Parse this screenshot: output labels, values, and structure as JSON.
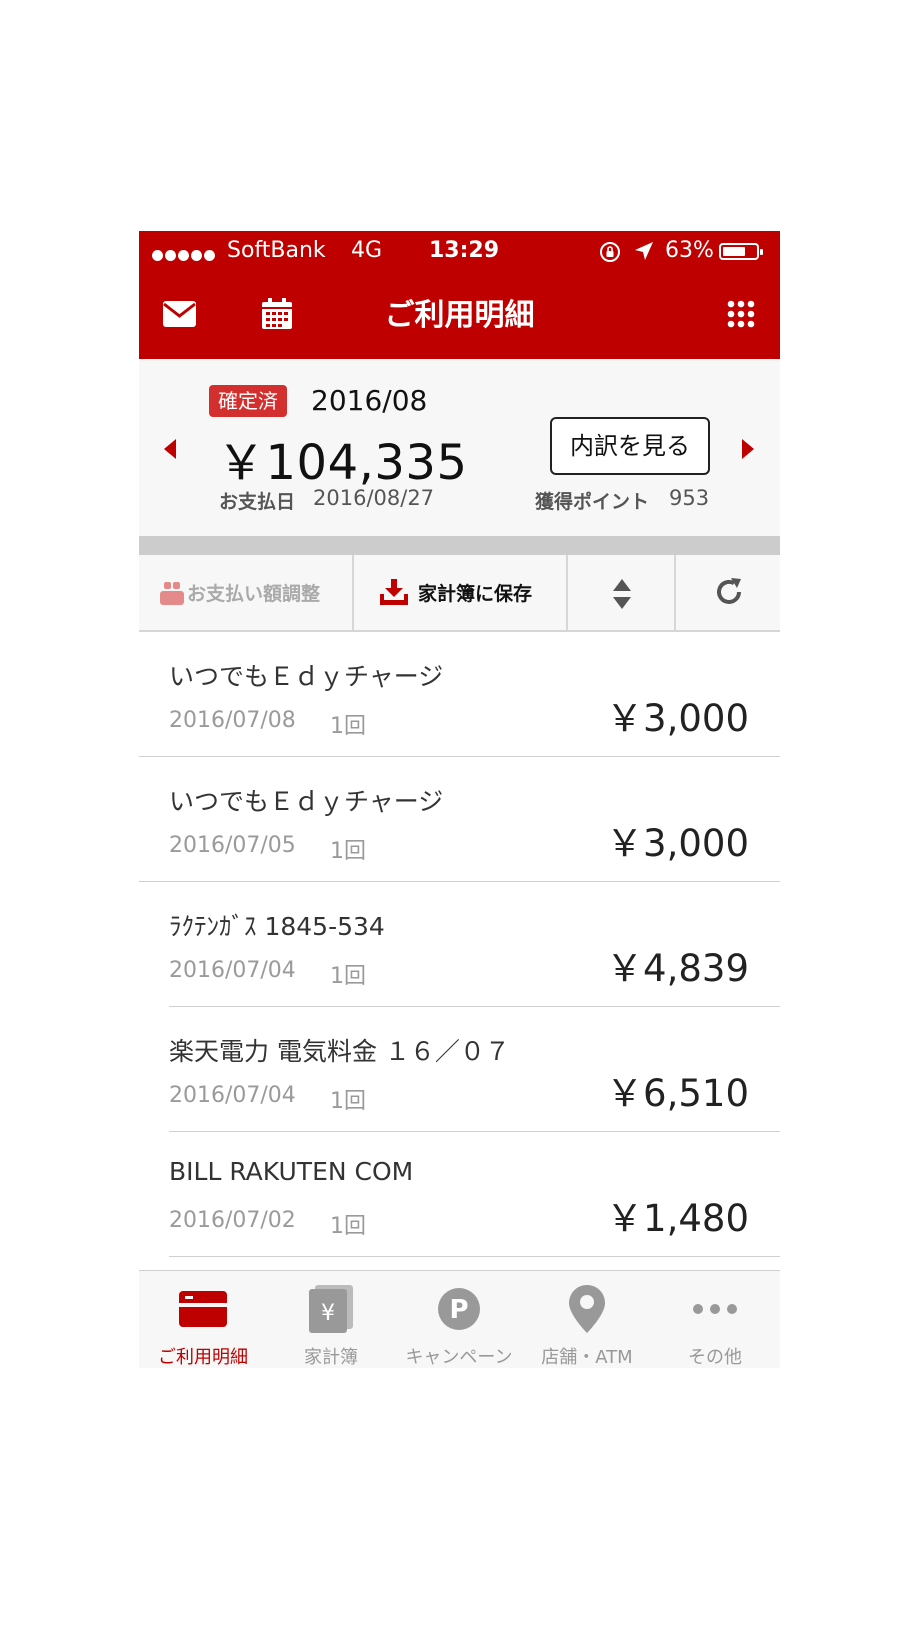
{
  "status_bar": {
    "carrier": "SoftBank",
    "network": "4G",
    "time": "13:29",
    "battery": "63%",
    "battery_level": 0.63
  },
  "header": {
    "title": "ご利用明細",
    "icons": [
      "mail-icon",
      "calendar-icon",
      "grid-menu-icon"
    ]
  },
  "summary": {
    "status_badge": "確定済",
    "month": "2016/08",
    "amount": "￥104,335",
    "detail_button": "内訳を見る",
    "pay_date_label": "お支払日",
    "pay_date": "2016/08/27",
    "points_label": "獲得ポイント",
    "points": "953"
  },
  "toolbar": {
    "adjust_label": "お支払い額調整",
    "save_label": "家計簿に保存"
  },
  "transactions": [
    {
      "name": "いつでもＥｄｙチャージ",
      "date": "2016/07/08",
      "count": "1回",
      "amount": "￥3,000"
    },
    {
      "name": "いつでもＥｄｙチャージ",
      "date": "2016/07/05",
      "count": "1回",
      "amount": "￥3,000"
    },
    {
      "name": "ﾗｸﾃﾝｶﾞｽ 1845-534",
      "date": "2016/07/04",
      "count": "1回",
      "amount": "￥4,839"
    },
    {
      "name": "楽天電力 電気料金 １６／０７",
      "date": "2016/07/04",
      "count": "1回",
      "amount": "￥6,510"
    },
    {
      "name": "BILL RAKUTEN COM",
      "date": "2016/07/02",
      "count": "1回",
      "amount": "￥1,480"
    }
  ],
  "tabs": [
    {
      "label": "ご利用明細",
      "icon": "credit-card-icon",
      "active": true
    },
    {
      "label": "家計簿",
      "icon": "household-book-icon",
      "active": false
    },
    {
      "label": "キャンペーン",
      "icon": "points-icon",
      "active": false
    },
    {
      "label": "店舗・ATM",
      "icon": "map-pin-icon",
      "active": false
    },
    {
      "label": "その他",
      "icon": "more-icon",
      "active": false
    }
  ],
  "colors": {
    "brand_red": "#bf0000",
    "badge_red": "#d32f2f",
    "inactive_gray": "#999999"
  }
}
